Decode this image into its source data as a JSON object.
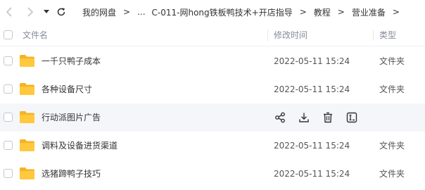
{
  "toolbar": {
    "back_icon": "chevron-left-icon",
    "forward_icon": "chevron-right-icon",
    "history_icon": "dropdown-caret-icon",
    "refresh_icon": "refresh-icon"
  },
  "breadcrumb": {
    "root": "我的网盘",
    "ellipsis": "...",
    "items": [
      "C-011-网hong铁板鸭技术+开店指导",
      "教程",
      "营业准备"
    ],
    "separator": ">"
  },
  "columns": {
    "name": "文件名",
    "modified": "修改时间",
    "type": "类型"
  },
  "files": [
    {
      "name": "一千只鸭子成本",
      "modified": "2022-05-11 15:24",
      "type": "文件夹"
    },
    {
      "name": "各种设备尺寸",
      "modified": "2022-05-11 15:24",
      "type": "文件夹"
    },
    {
      "name": "行动派图片广告",
      "modified": "",
      "type": "",
      "hovered": true
    },
    {
      "name": "调料及设备进货渠道",
      "modified": "2022-05-11 15:24",
      "type": "文件夹"
    },
    {
      "name": "选猪蹄鸭子技巧",
      "modified": "2022-05-11 15:24",
      "type": "文件夹"
    }
  ],
  "row_actions": [
    "share-icon",
    "download-icon",
    "delete-icon",
    "rename-icon"
  ],
  "colors": {
    "folder": "#ffc83d",
    "folder_back": "#f5b324",
    "hover_row": "#f5f6fa",
    "header_text": "#878c9c",
    "disabled_nav": "#c0c4cc"
  }
}
